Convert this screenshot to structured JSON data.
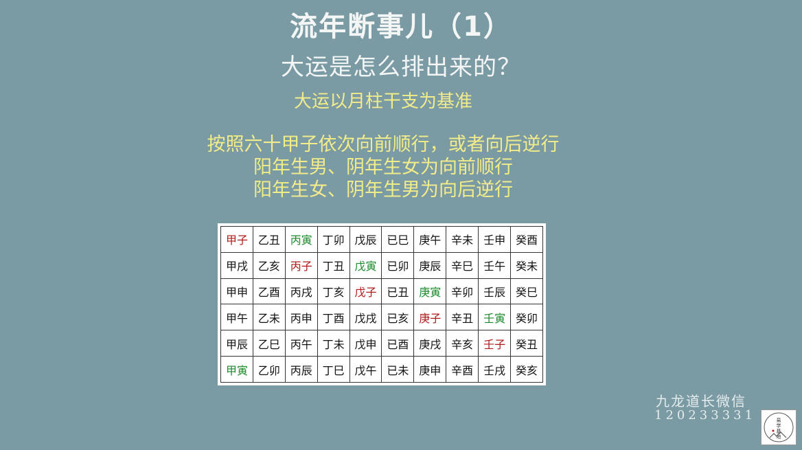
{
  "title": "流年断事儿（1）",
  "subtitle": "大运是怎么排出来的？",
  "basis": "大运以月柱干支为基准",
  "rules": [
    "按照六十甲子依次向前顺行，或者向后逆行",
    "阳年生男、阴年生女为向前顺行",
    "阳年生女、阴年生男为向后逆行"
  ],
  "jiazi_table": {
    "rows": [
      [
        {
          "t": "甲子",
          "c": "red"
        },
        {
          "t": "乙丑"
        },
        {
          "t": "丙寅",
          "c": "green"
        },
        {
          "t": "丁卯"
        },
        {
          "t": "戊辰"
        },
        {
          "t": "已巳"
        },
        {
          "t": "庚午"
        },
        {
          "t": "辛未"
        },
        {
          "t": "壬申"
        },
        {
          "t": "癸酉"
        }
      ],
      [
        {
          "t": "甲戌"
        },
        {
          "t": "乙亥"
        },
        {
          "t": "丙子",
          "c": "red"
        },
        {
          "t": "丁丑"
        },
        {
          "t": "戊寅",
          "c": "green"
        },
        {
          "t": "已卯"
        },
        {
          "t": "庚辰"
        },
        {
          "t": "辛巳"
        },
        {
          "t": "壬午"
        },
        {
          "t": "癸未"
        }
      ],
      [
        {
          "t": "甲申"
        },
        {
          "t": "乙酉"
        },
        {
          "t": "丙戌"
        },
        {
          "t": "丁亥"
        },
        {
          "t": "戊子",
          "c": "red"
        },
        {
          "t": "已丑"
        },
        {
          "t": "庚寅",
          "c": "green"
        },
        {
          "t": "辛卯"
        },
        {
          "t": "壬辰"
        },
        {
          "t": "癸巳"
        }
      ],
      [
        {
          "t": "甲午"
        },
        {
          "t": "乙未"
        },
        {
          "t": "丙申"
        },
        {
          "t": "丁酉"
        },
        {
          "t": "戊戌"
        },
        {
          "t": "已亥"
        },
        {
          "t": "庚子",
          "c": "red"
        },
        {
          "t": "辛丑"
        },
        {
          "t": "壬寅",
          "c": "green"
        },
        {
          "t": "癸卯"
        }
      ],
      [
        {
          "t": "甲辰"
        },
        {
          "t": "乙巳"
        },
        {
          "t": "丙午"
        },
        {
          "t": "丁未"
        },
        {
          "t": "戊申"
        },
        {
          "t": "已酉"
        },
        {
          "t": "庚戌"
        },
        {
          "t": "辛亥"
        },
        {
          "t": "壬子",
          "c": "red"
        },
        {
          "t": "癸丑"
        }
      ],
      [
        {
          "t": "甲寅",
          "c": "green"
        },
        {
          "t": "乙卯"
        },
        {
          "t": "丙辰"
        },
        {
          "t": "丁巳"
        },
        {
          "t": "戊午"
        },
        {
          "t": "已未"
        },
        {
          "t": "庚申"
        },
        {
          "t": "辛酉"
        },
        {
          "t": "壬戌"
        },
        {
          "t": "癸亥"
        }
      ]
    ]
  },
  "watermark": {
    "name": "九龙道长微信",
    "number": "120233331",
    "logo_text": "易学基地"
  },
  "colors": {
    "background": "#7a9aa4",
    "highlight_text": "#f3ec8a",
    "red": "#b01818",
    "green": "#1a8a2a"
  }
}
